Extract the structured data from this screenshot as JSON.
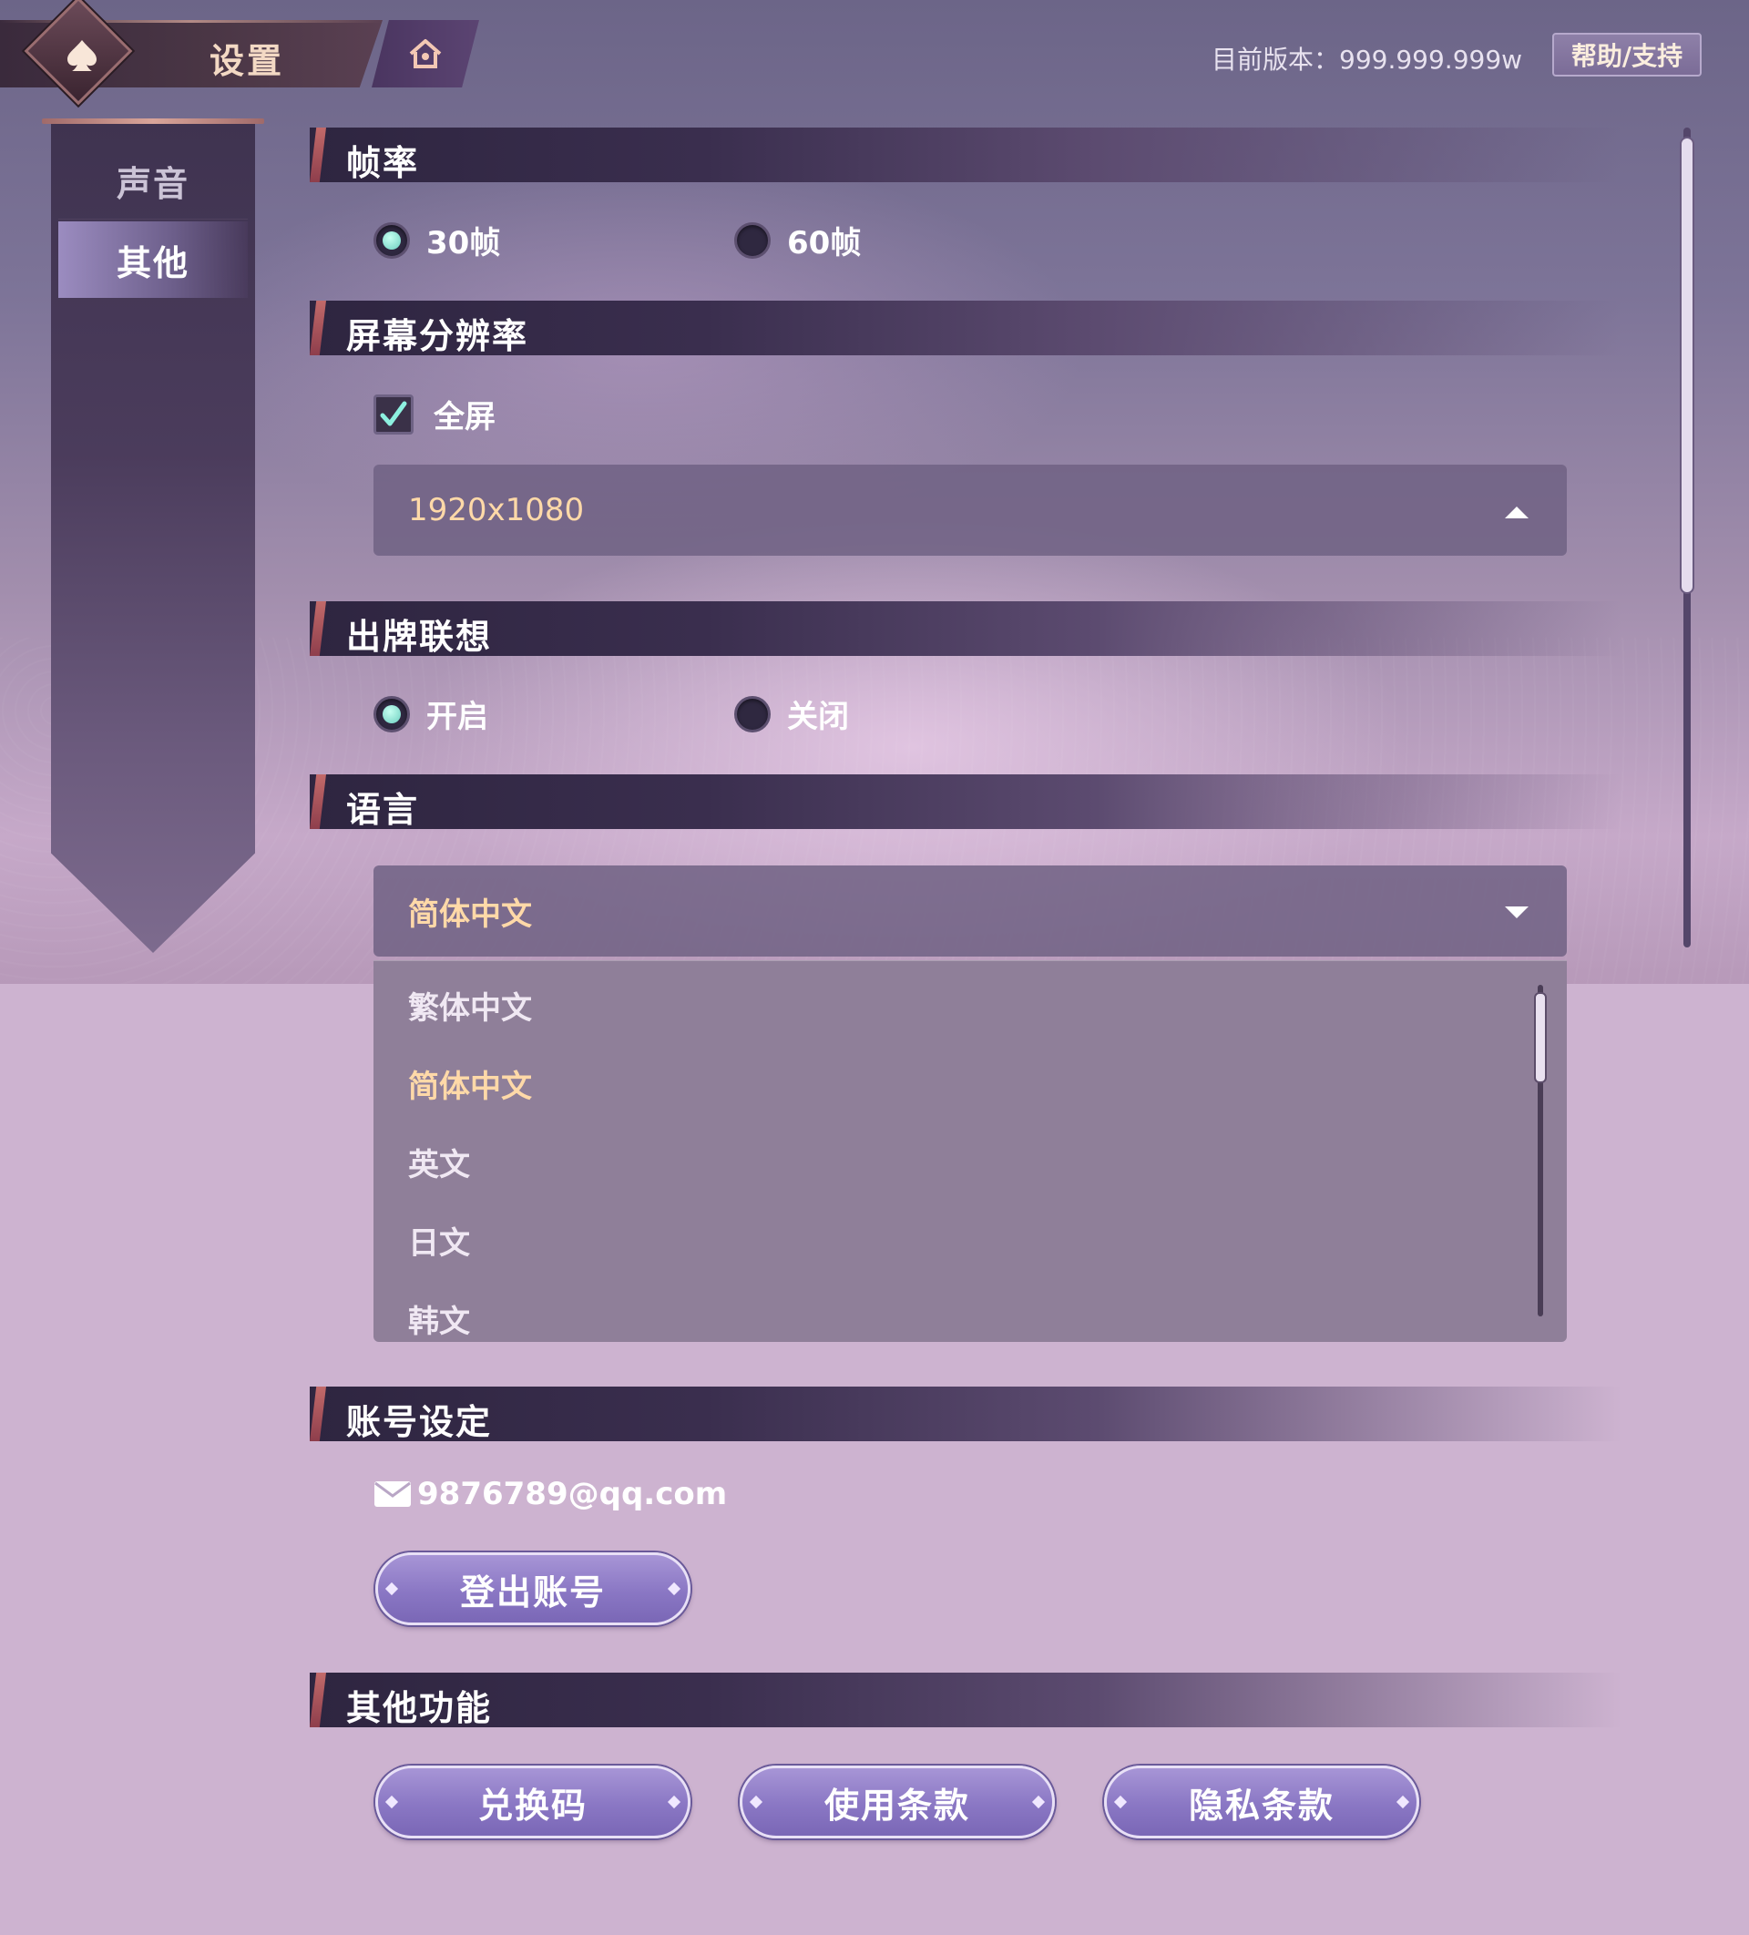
{
  "header": {
    "title": "设置",
    "version_text": "目前版本：999.999.999w",
    "help_label": "帮助/支持"
  },
  "sidebar": {
    "items": [
      {
        "label": "声音",
        "active": false
      },
      {
        "label": "其他",
        "active": true
      }
    ]
  },
  "sections": {
    "frame_rate": {
      "title": "帧率",
      "options": [
        {
          "label": "30帧",
          "selected": true
        },
        {
          "label": "60帧",
          "selected": false
        }
      ]
    },
    "resolution": {
      "title": "屏幕分辨率",
      "fullscreen_label": "全屏",
      "fullscreen_checked": true,
      "resolution_value": "1920x1080"
    },
    "card_suggest": {
      "title": "出牌联想",
      "options": [
        {
          "label": "开启",
          "selected": true
        },
        {
          "label": "关闭",
          "selected": false
        }
      ]
    },
    "language": {
      "title": "语言",
      "selected": "简体中文",
      "options": [
        "繁体中文",
        "简体中文",
        "英文",
        "日文",
        "韩文"
      ]
    },
    "account": {
      "title": "账号设定",
      "email": "9876789@qq.com",
      "logout_label": "登出账号"
    },
    "other": {
      "title": "其他功能",
      "buttons": [
        "兑换码",
        "使用条款",
        "隐私条款"
      ]
    }
  },
  "colors": {
    "accent_text": "#ffd9a8",
    "radio_on": "#6ccfc0",
    "button_purple": "#8a77c4",
    "section_marker": "#c26a6a"
  }
}
